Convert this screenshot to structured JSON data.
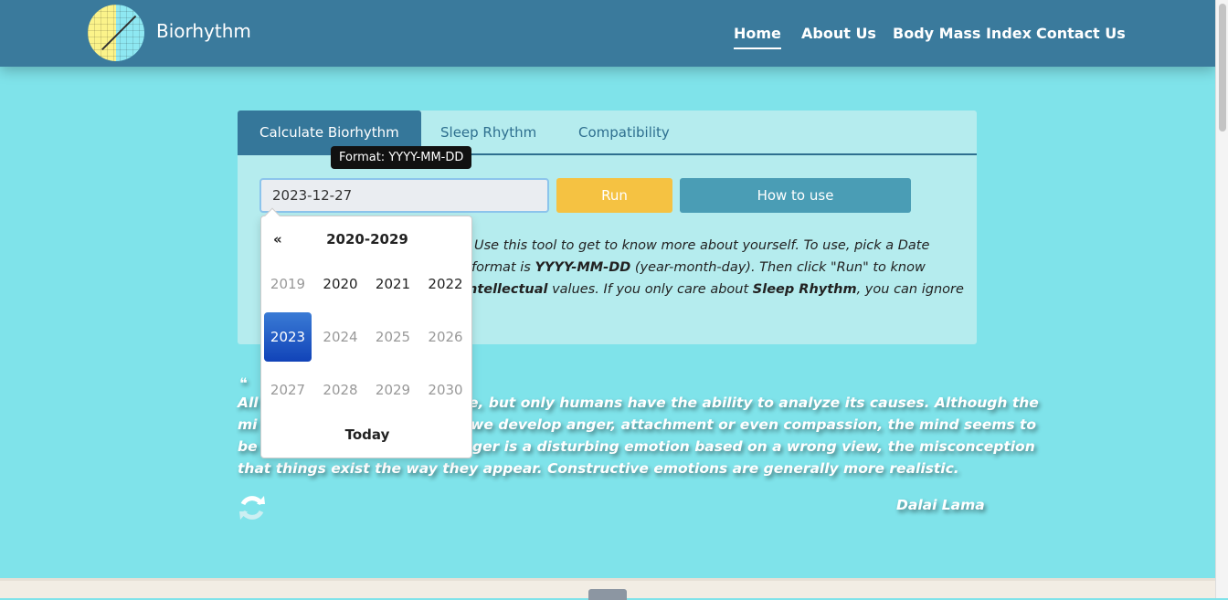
{
  "nav": {
    "brand": "Biorhythm",
    "links": [
      "Home",
      "About Us",
      "Body Mass Index",
      "Contact Us"
    ],
    "active": "Home"
  },
  "tabs": [
    "Calculate Biorhythm",
    "Sleep Rhythm",
    "Compatibility"
  ],
  "form": {
    "date_value": "2023-12-27",
    "tooltip": "Format: YYYY-MM-DD",
    "run_label": "Run",
    "howto_label": "How to use"
  },
  "description": {
    "line1": "Use this tool to get to know more about yourself. To use, pick a Date",
    "line2_pre": "format is ",
    "line2_bold": "YYYY-MM-DD",
    "line2_post": " (year-month-day). Then click \"Run\" to know",
    "line3_bold1": "ntellectual",
    "line3_mid": " values. If you only care about ",
    "line3_bold2": "Sleep Rhythm",
    "line3_post": ", you can ignore"
  },
  "datepicker": {
    "prev": "«",
    "range": "2020-2029",
    "years": [
      "2019",
      "2020",
      "2021",
      "2022",
      "2023",
      "2024",
      "2025",
      "2026",
      "2027",
      "2028",
      "2029",
      "2030"
    ],
    "selected": "2023",
    "today": "Today"
  },
  "quote": {
    "mark": "❝",
    "l1a": "All",
    "l1b": "e, but only humans have the ability to analyze its causes. Although the",
    "l2a": "mi",
    "l2b": "we develop anger, attachment or even compassion, the mind seems to",
    "l3a": "be",
    "l3b": "ger is a disturbing emotion based on a wrong view, the misconception",
    "l4": "that things exist the way they appear. Constructive emotions are generally more realistic.",
    "author": "Dalai Lama"
  },
  "colors": {
    "nav": "#3a7a9c",
    "background": "#7fe3ea",
    "run": "#f5c242",
    "howto": "#4a9db5",
    "selected": "#1f5fc8"
  }
}
